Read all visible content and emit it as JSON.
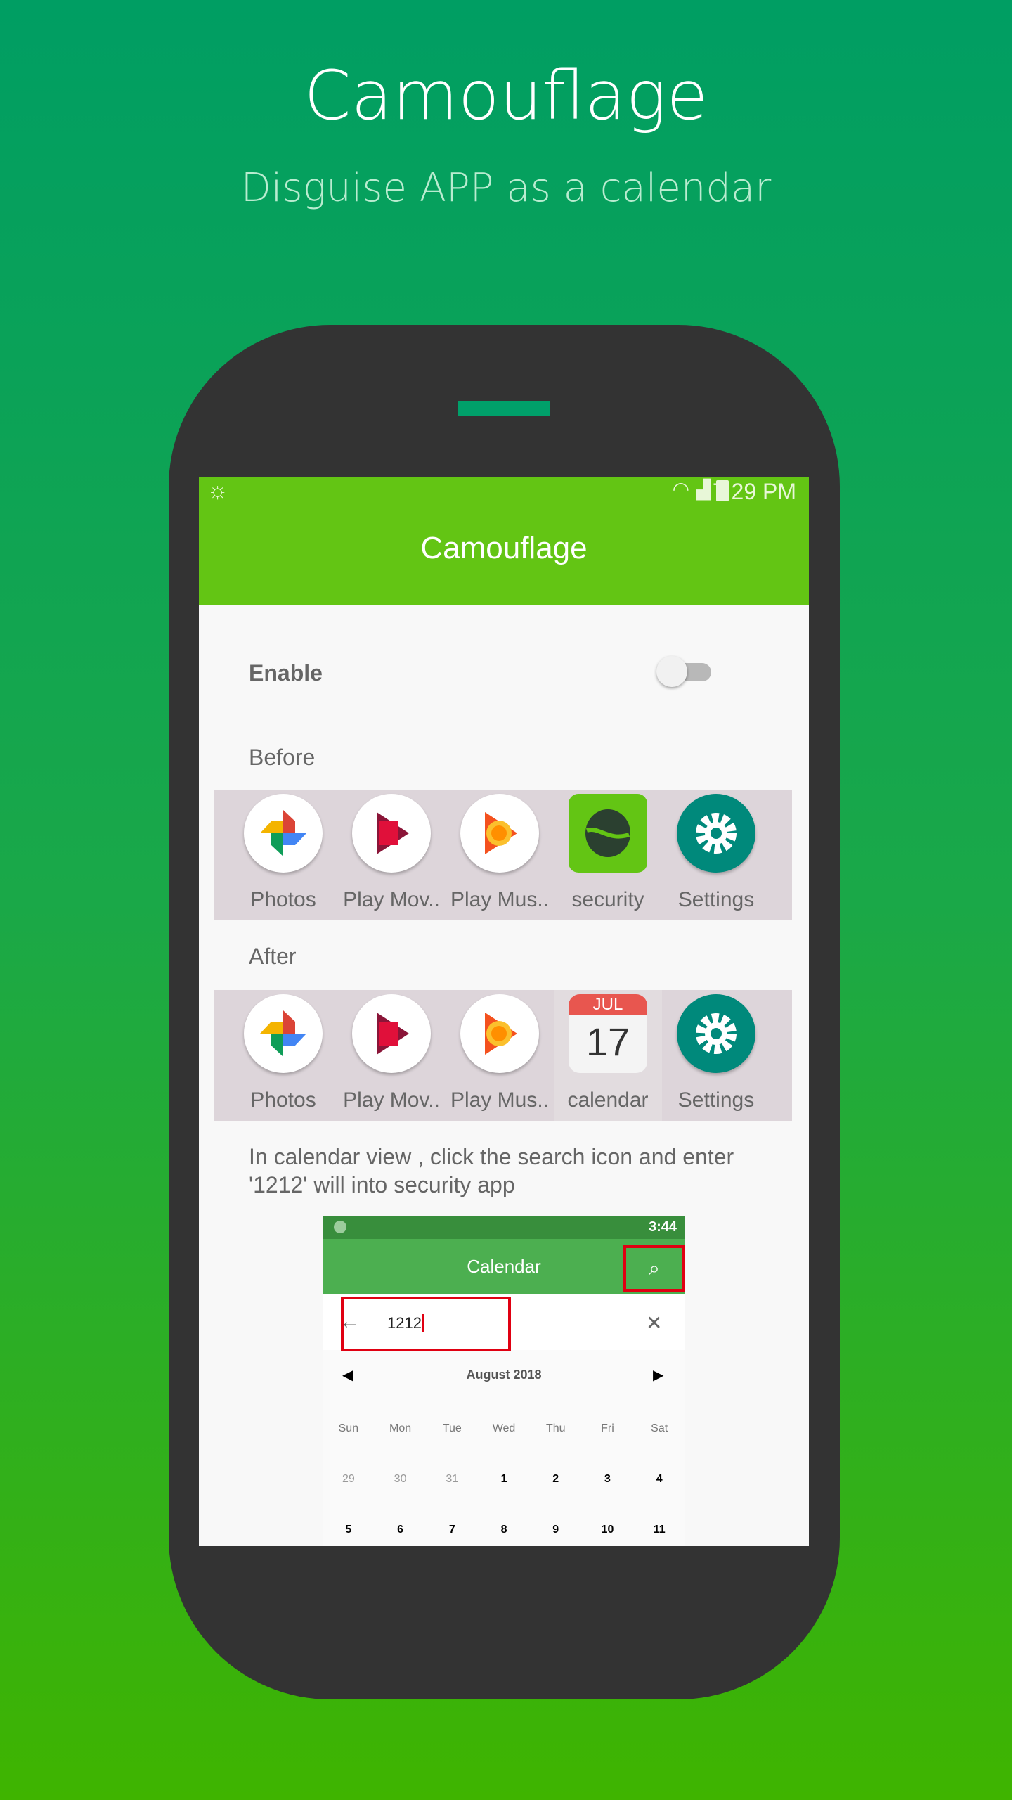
{
  "header": {
    "title": "Camouflage",
    "subtitle": "Disguise APP as a calendar"
  },
  "colors": {
    "background_top": "#009e63",
    "background_bottom": "#3fb400",
    "app_bar": "#63c514",
    "phone_body": "#333333",
    "highlight_box": "#e00012"
  },
  "status_bar": {
    "time": "7:29 PM",
    "icons": [
      "weather-icon",
      "wifi-icon",
      "signal-icon",
      "battery-charging-icon"
    ]
  },
  "app_bar": {
    "title": "Camouflage"
  },
  "settings": {
    "enable_label": "Enable",
    "enable_on": false,
    "before_label": "Before",
    "after_label": "After"
  },
  "before_apps": [
    {
      "name": "Photos"
    },
    {
      "name": "Play Mov.."
    },
    {
      "name": "Play Mus.."
    },
    {
      "name": "security"
    },
    {
      "name": "Settings"
    }
  ],
  "after_apps": [
    {
      "name": "Photos"
    },
    {
      "name": "Play Mov.."
    },
    {
      "name": "Play Mus.."
    },
    {
      "name": "calendar",
      "month": "JUL",
      "day": "17"
    },
    {
      "name": "Settings"
    }
  ],
  "instruction": "In calendar view , click the search icon and enter '1212' will into security app",
  "calendar_screenshot": {
    "time": "3:44",
    "title": "Calendar",
    "search_value": "1212",
    "month": "August 2018",
    "weekdays": [
      "Sun",
      "Mon",
      "Tue",
      "Wed",
      "Thu",
      "Fri",
      "Sat"
    ],
    "week1": [
      "29",
      "30",
      "31",
      "1",
      "2",
      "3",
      "4"
    ],
    "week2": [
      "5",
      "6",
      "7",
      "8",
      "9",
      "10",
      "11"
    ]
  }
}
